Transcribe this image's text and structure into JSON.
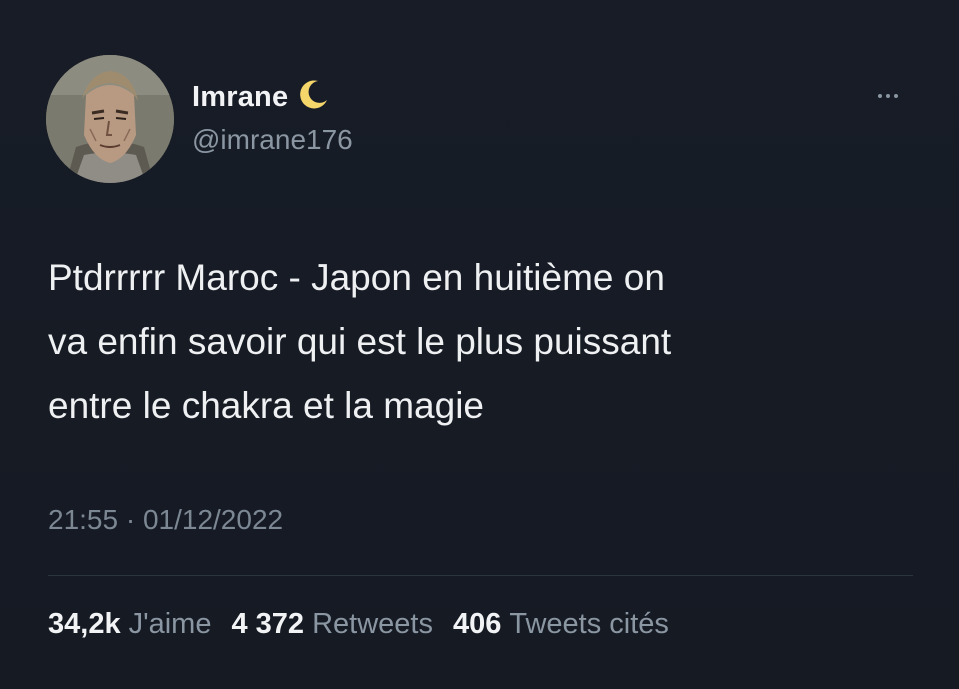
{
  "tweet": {
    "display_name": "Imrane",
    "name_emoji": "🌙",
    "handle": "@imrane176",
    "body_lines": [
      "Ptdrrrrr Maroc - Japon en huitième on",
      "va enfin savoir qui est le plus puissant",
      "entre le chakra et la magie"
    ],
    "timestamp": "21:55 · 01/12/2022",
    "stats": {
      "likes_count": "34,2k",
      "likes_label": "J'aime",
      "retweets_count": "4 372",
      "retweets_label": "Retweets",
      "quotes_count": "406",
      "quotes_label": "Tweets cités"
    }
  },
  "colors": {
    "background": "#161b25",
    "primary_text": "#eef0f2",
    "secondary_text": "#8b96a3",
    "divider": "#2c3440",
    "moon": "#f5d66b"
  },
  "icons": {
    "more": "more-horizontal-icon",
    "moon": "crescent-moon-icon",
    "avatar": "anime-character-avatar"
  }
}
